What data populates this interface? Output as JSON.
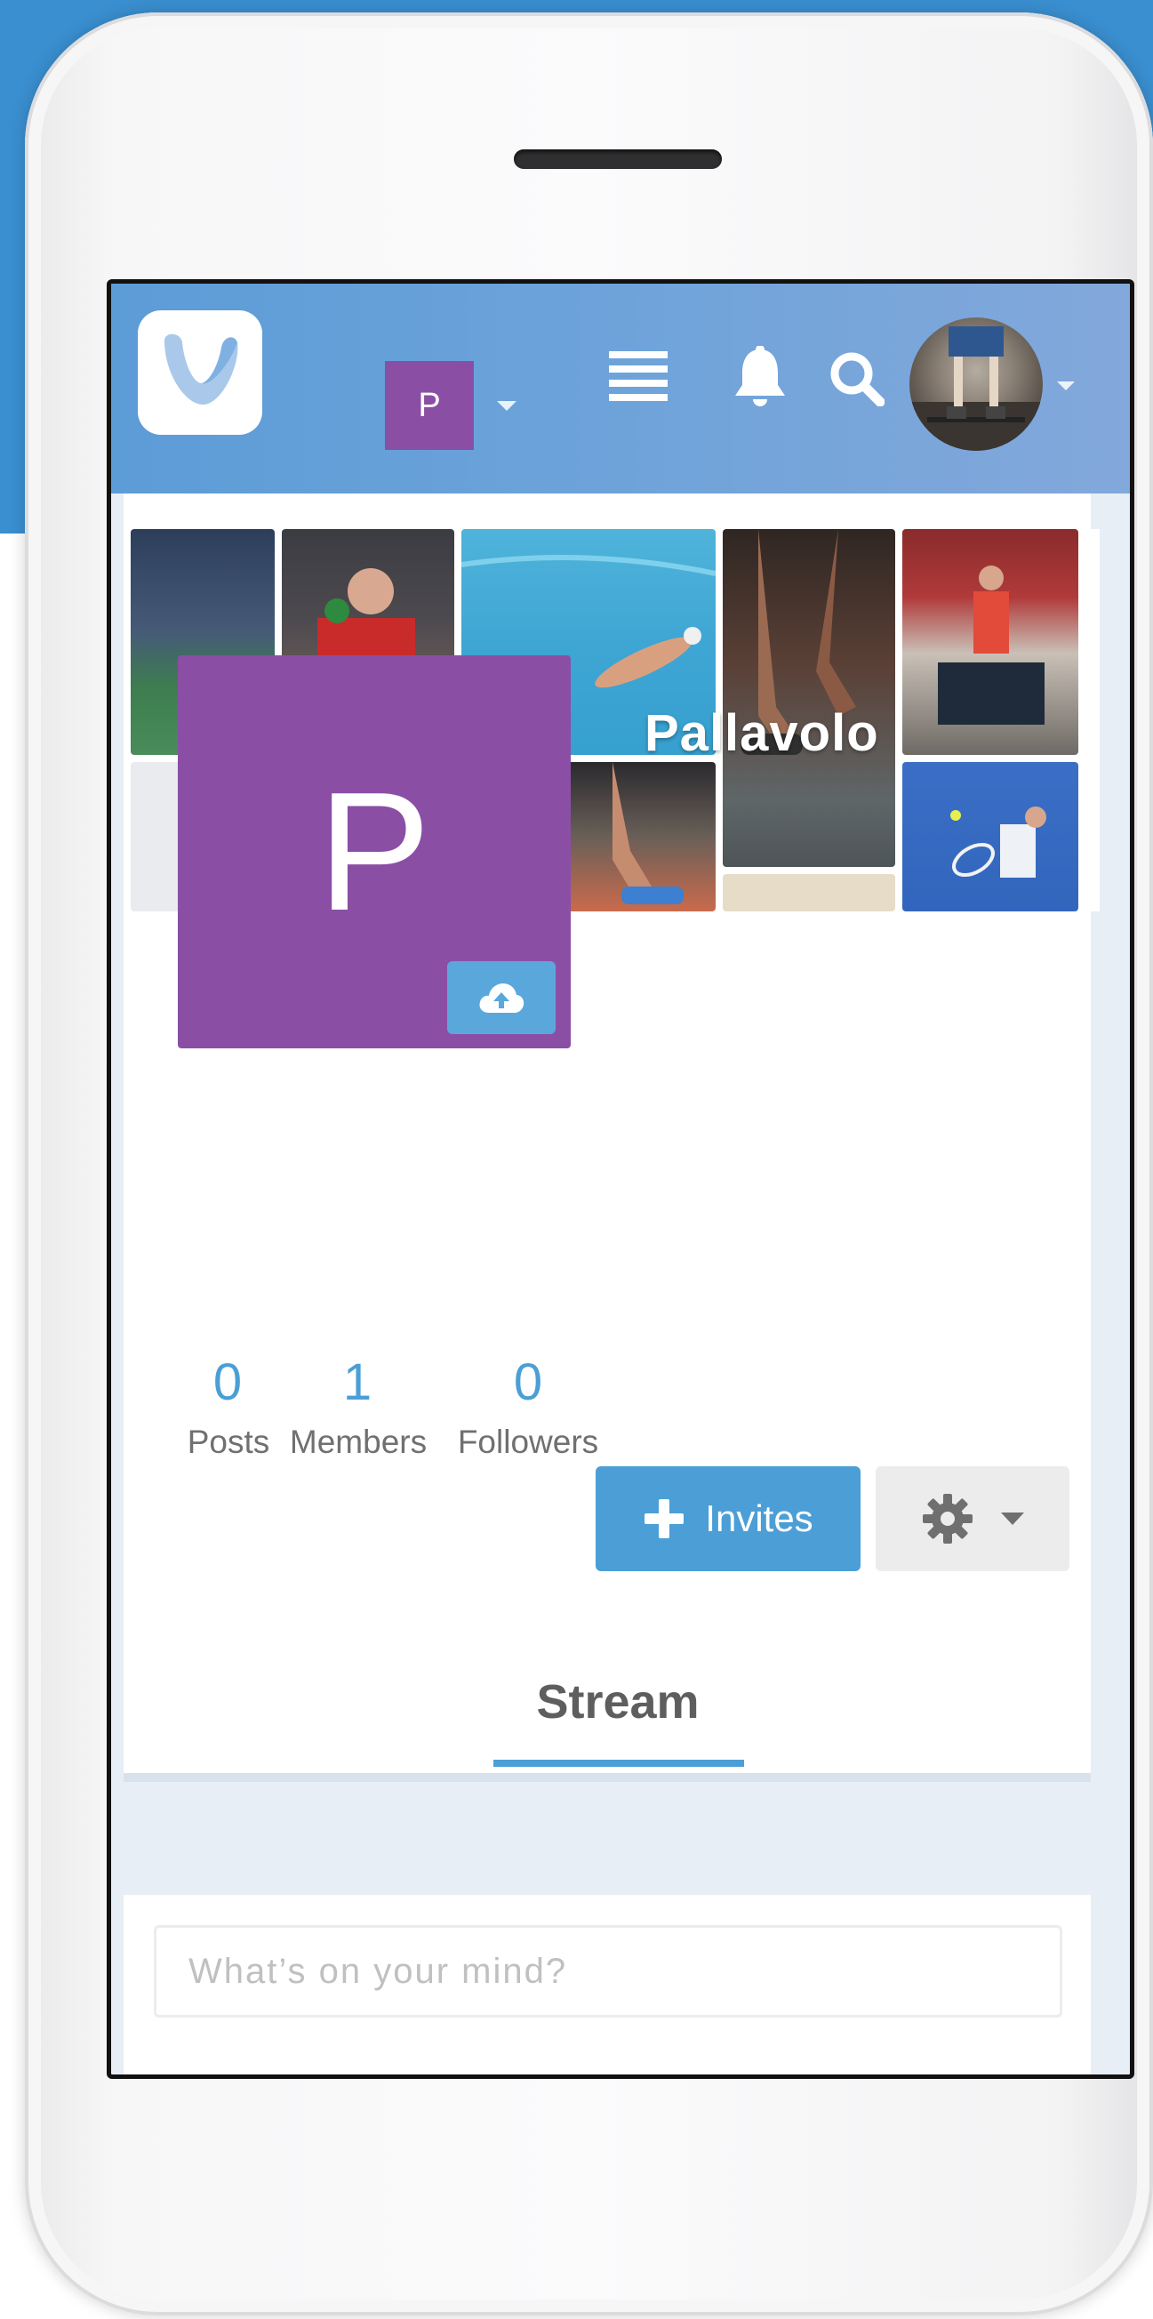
{
  "header": {
    "space_initial": "P",
    "icons": [
      "menu-icon",
      "bell-icon",
      "search-icon",
      "chevron-down-icon"
    ]
  },
  "group": {
    "name": "Pallavolo",
    "initial": "P",
    "color": "#8a4fa5"
  },
  "stats": [
    {
      "value": "0",
      "label": "Posts"
    },
    {
      "value": "1",
      "label": "Members"
    },
    {
      "value": "0",
      "label": "Followers"
    }
  ],
  "actions": {
    "invite_label": "Invites",
    "settings_icon": "gear-icon"
  },
  "tabs": {
    "stream": "Stream"
  },
  "composer": {
    "placeholder": "What’s on your mind?"
  },
  "colors": {
    "accent": "#4b9fd6",
    "brand_purple": "#8a4fa5",
    "header_blue": "#6ea3da"
  }
}
